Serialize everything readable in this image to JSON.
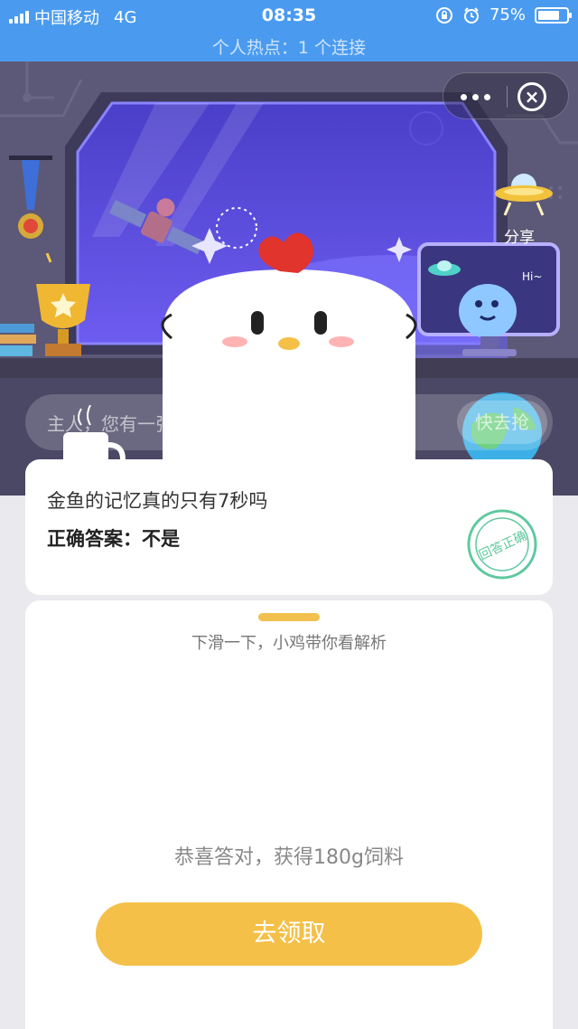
{
  "status_bar": {
    "carrier": "中国移动",
    "network": "4G",
    "time": "08:35",
    "battery_percent": "75%",
    "battery_level": 0.75,
    "hotspot": "个人热点：1 个连接"
  },
  "scene": {
    "share_label": "分享",
    "hi_text": "Hi~",
    "banner_text": "主人，您有一张消费券待领取",
    "banner_button": "快去抢"
  },
  "question_card": {
    "question": "金鱼的记忆真的只有7秒吗",
    "answer_label": "正确答案：",
    "answer_value": "不是",
    "stamp_text": "回答正确"
  },
  "reward_card": {
    "hint": "下滑一下，小鸡带你看解析",
    "congrats": "恭喜答对，获得180g饲料",
    "claim_button": "去领取"
  },
  "colors": {
    "status_bar": "#4a9bf0",
    "accent_yellow": "#f4c048",
    "stamp_green": "#5fc8a0",
    "comb_red": "#e0342c"
  }
}
